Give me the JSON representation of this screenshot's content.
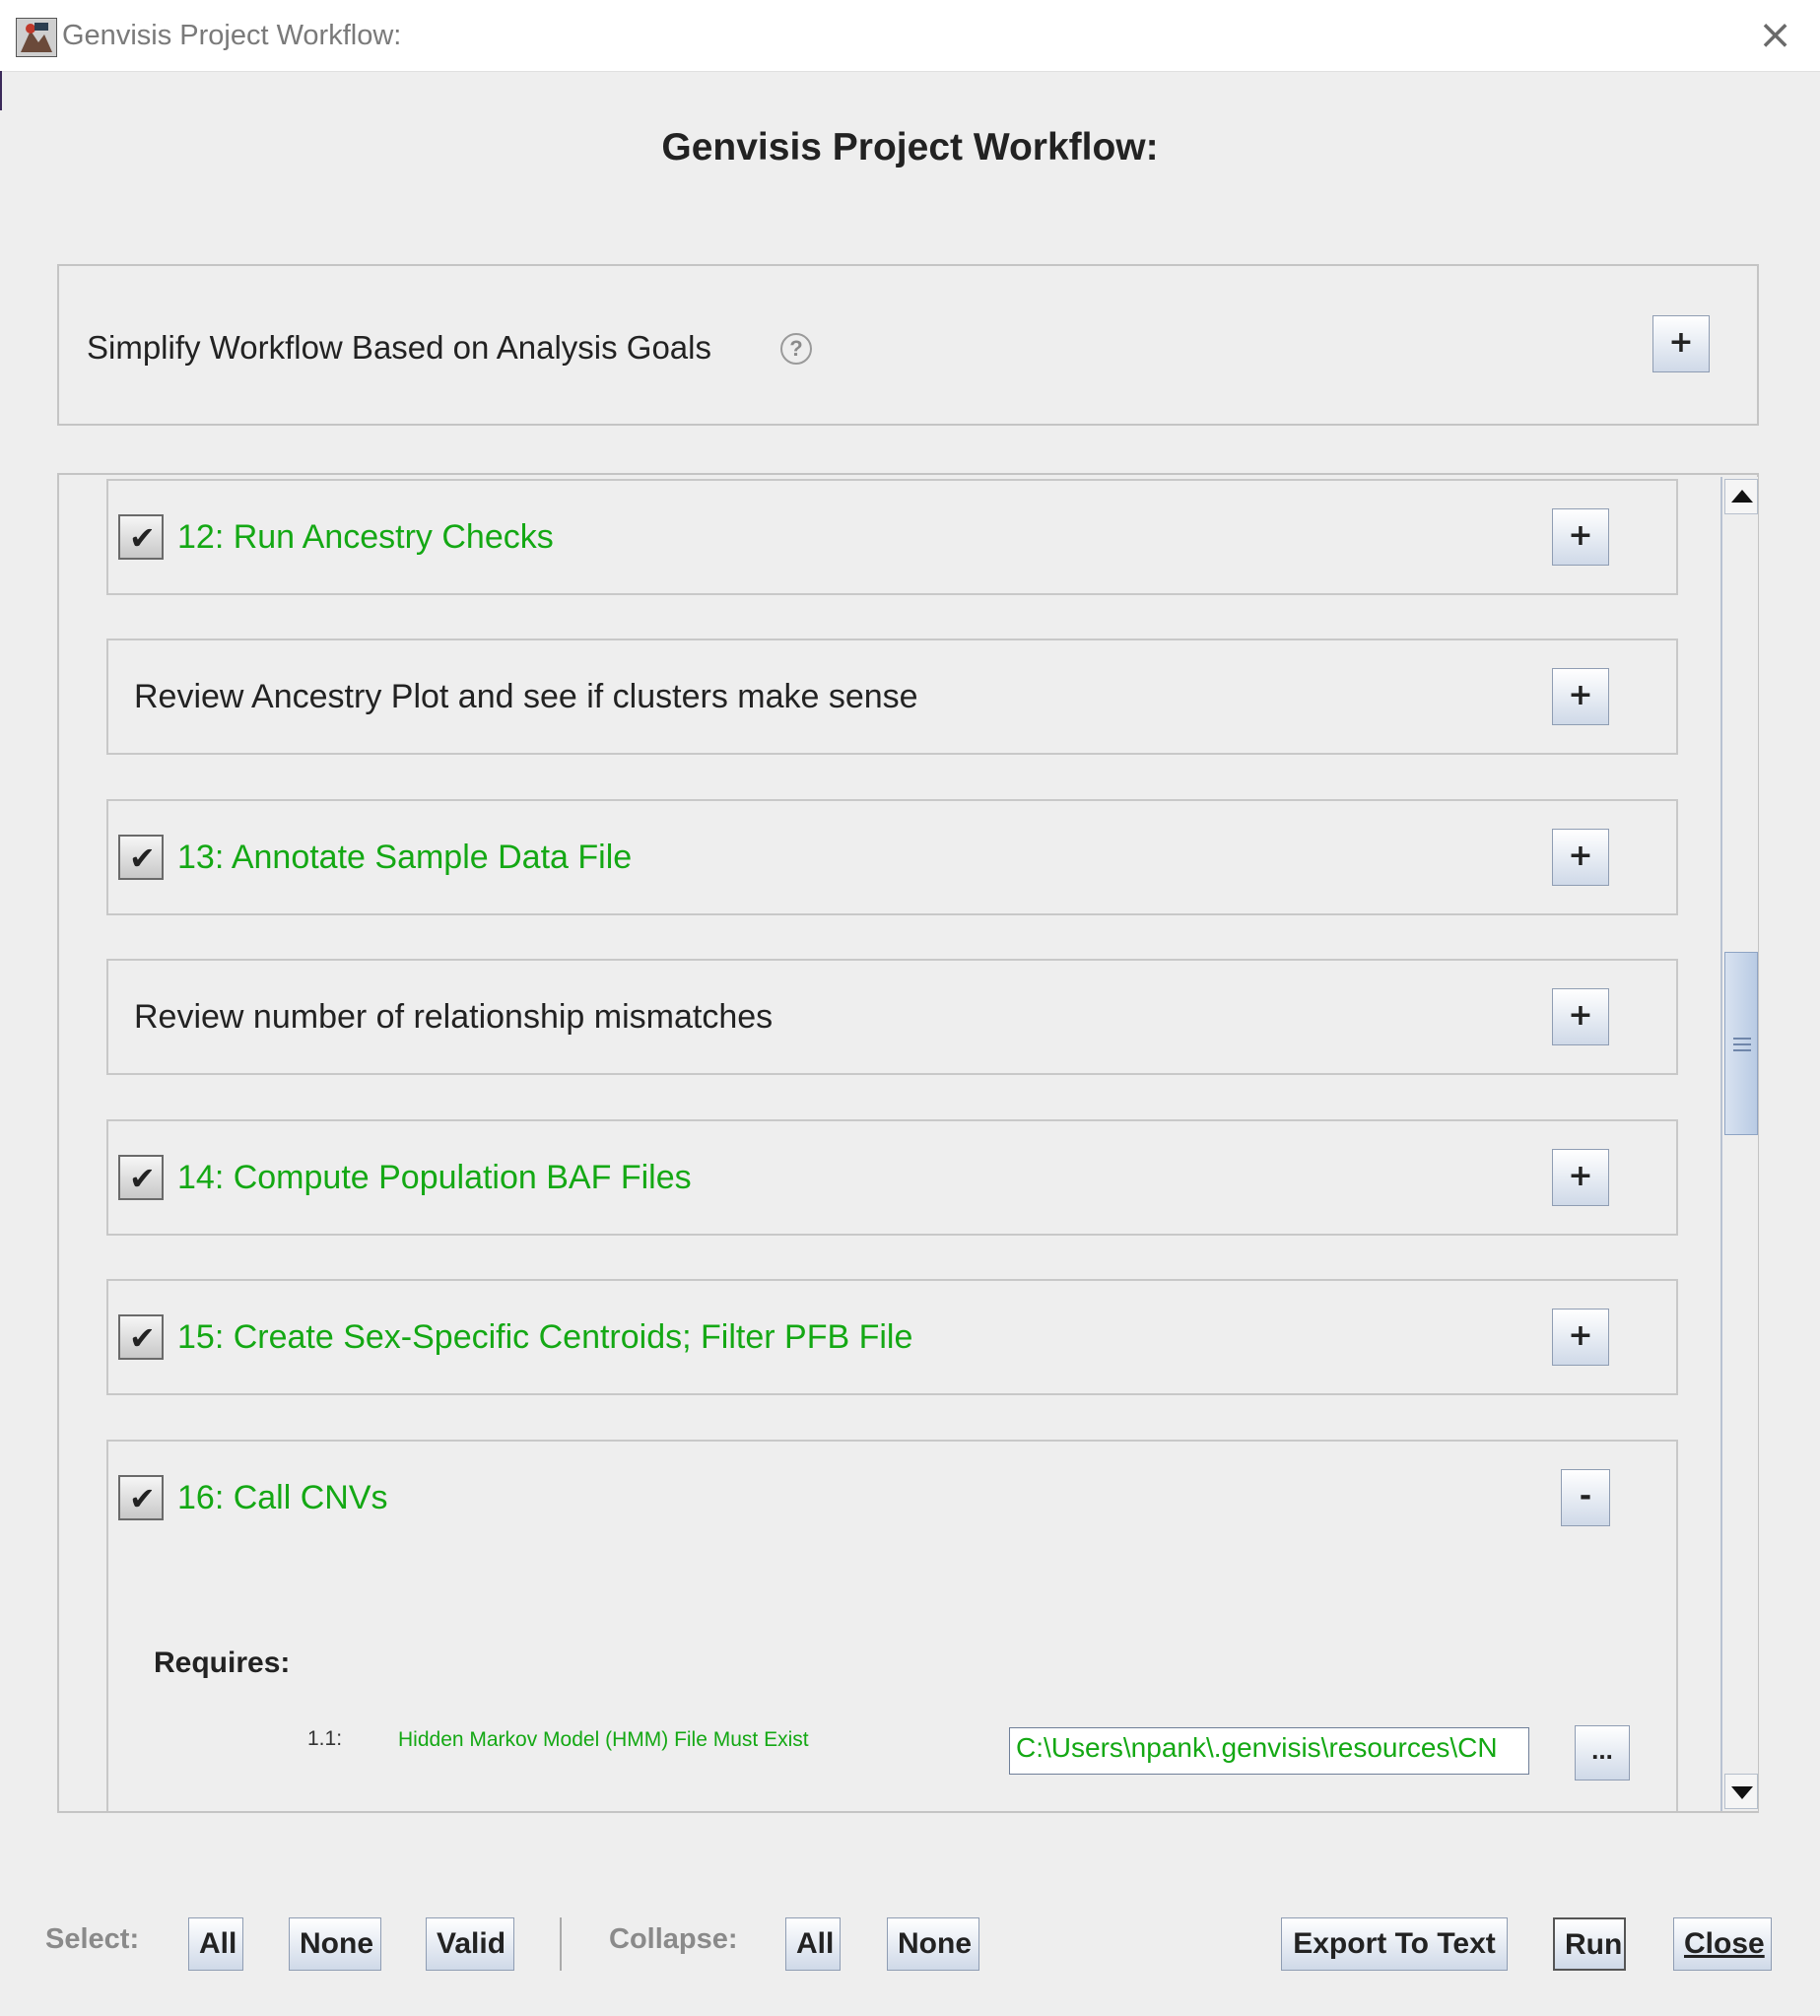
{
  "window": {
    "title": "Genvisis Project Workflow:",
    "close_glyph": "×"
  },
  "heading": "Genvisis Project Workflow:",
  "goals": {
    "label": "Simplify Workflow Based on Analysis Goals",
    "help_glyph": "?",
    "expand_glyph": "+"
  },
  "steps": [
    {
      "label": "12: Run Ancestry Checks",
      "checked": true,
      "expand_glyph": "+"
    },
    {
      "label": "Review Ancestry Plot and see if clusters make sense",
      "expand_glyph": "+"
    },
    {
      "label": "13: Annotate Sample Data File",
      "checked": true,
      "expand_glyph": "+"
    },
    {
      "label": "Review number of relationship mismatches",
      "expand_glyph": "+"
    },
    {
      "label": "14: Compute Population BAF Files",
      "checked": true,
      "expand_glyph": "+"
    },
    {
      "label": "15: Create Sex-Specific Centroids; Filter PFB File",
      "checked": true,
      "expand_glyph": "+"
    },
    {
      "label": "16: Call CNVs",
      "checked": true,
      "expand_glyph": "-"
    }
  ],
  "requires": {
    "title": "Requires:",
    "items": [
      {
        "num": "1.1:",
        "text": "Hidden Markov Model (HMM) File Must Exist",
        "value": "C:\\Users\\npank\\.genvisis\\resources\\CN",
        "browse_label": "..."
      }
    ]
  },
  "check_glyph": "✔",
  "bottom": {
    "select_label": "Select:",
    "select_all": "All",
    "select_none": "None",
    "select_valid": "Valid",
    "collapse_label": "Collapse:",
    "collapse_all": "All",
    "collapse_none": "None",
    "export": "Export To Text",
    "run": "Run",
    "close": "Close"
  },
  "colors": {
    "step_text": "#14a814",
    "background": "#eeeeee",
    "button_border": "#8f9db3"
  }
}
